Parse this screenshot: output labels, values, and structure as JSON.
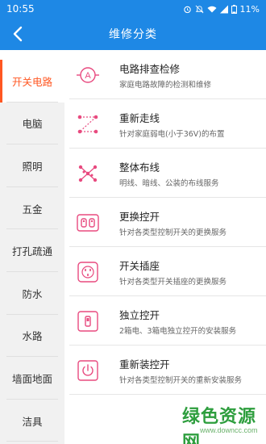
{
  "status_bar": {
    "time": "10:55",
    "battery": "11%"
  },
  "header": {
    "title": "维修分类"
  },
  "sidebar": {
    "items": [
      {
        "label": "开关电路",
        "active": true
      },
      {
        "label": "电脑",
        "active": false
      },
      {
        "label": "照明",
        "active": false
      },
      {
        "label": "五金",
        "active": false
      },
      {
        "label": "打孔疏通",
        "active": false
      },
      {
        "label": "防水",
        "active": false
      },
      {
        "label": "水路",
        "active": false
      },
      {
        "label": "墙面地面",
        "active": false
      },
      {
        "label": "洁具",
        "active": false
      }
    ]
  },
  "services": [
    {
      "title": "电路排查检修",
      "desc": "家庭电路故障的检测和维修",
      "icon": "circuit-a-icon"
    },
    {
      "title": "重新走线",
      "desc": "针对家庭弱电(小于36V)的布置",
      "icon": "rewire-icon"
    },
    {
      "title": "整体布线",
      "desc": "明线、暗线、公装的布线服务",
      "icon": "wiring-network-icon"
    },
    {
      "title": "更换控开",
      "desc": "针对各类型控制开关的更换服务",
      "icon": "switch-replace-icon"
    },
    {
      "title": "开关插座",
      "desc": "针对各类型开关插座的更换服务",
      "icon": "socket-icon"
    },
    {
      "title": "独立控开",
      "desc": "2箱电、3箱电独立控开的安装服务",
      "icon": "single-switch-icon"
    },
    {
      "title": "重新装控开",
      "desc": "针对各类型控制开关的重新安装服务",
      "icon": "power-switch-icon"
    }
  ],
  "watermark": {
    "logo": "绿色资源网",
    "url": "www.downcc.com"
  },
  "colors": {
    "primary": "#1e88e5",
    "accent": "#ff5722",
    "icon_pink": "#e84a7f"
  }
}
